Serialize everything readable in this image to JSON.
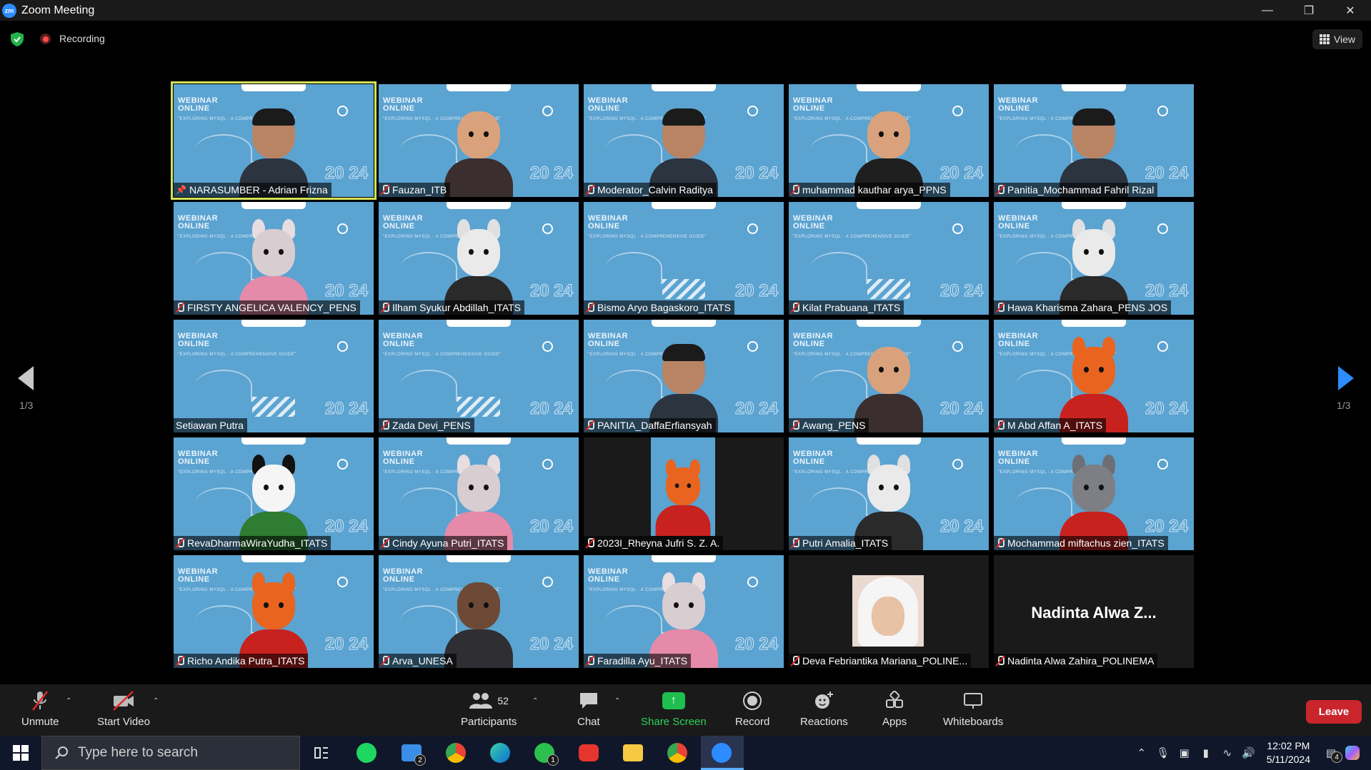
{
  "window": {
    "title": "Zoom Meeting",
    "app_icon": "zm"
  },
  "topbar": {
    "recording_label": "Recording",
    "view_label": "View"
  },
  "pager": {
    "left": "1/3",
    "right": "1/3"
  },
  "tiles": [
    {
      "name": "NARASUMBER - Adrian Frizna",
      "type": "camera",
      "active": true,
      "muted": false,
      "pinned": true
    },
    {
      "name": "Fauzan_ITB",
      "type": "avatar",
      "avatar": "cartoon-man-glasses",
      "muted": true
    },
    {
      "name": "Moderator_Calvin Raditya",
      "type": "camera",
      "muted": true
    },
    {
      "name": "muhammad kauthar arya_PPNS",
      "type": "avatar",
      "avatar": "cartoon-man-sunglasses",
      "muted": true
    },
    {
      "name": "Panitia_Mochammad Fahril Rizal",
      "type": "camera",
      "muted": true
    },
    {
      "name": "FIRSTY ANGELICA VALENCY_PENS",
      "type": "avatar",
      "avatar": "rabbit",
      "muted": true
    },
    {
      "name": "Ilham Syukur Abdillah_ITATS",
      "type": "avatar",
      "avatar": "white-bear",
      "muted": true
    },
    {
      "name": "Bismo Aryo Bagaskoro_ITATS",
      "type": "background",
      "muted": true
    },
    {
      "name": "Kilat Prabuana_ITATS",
      "type": "background",
      "muted": true
    },
    {
      "name": "Hawa Kharisma Zahara_PENS JOS",
      "type": "avatar",
      "avatar": "white-bear",
      "muted": true
    },
    {
      "name": "Setiawan Putra",
      "type": "background",
      "muted": false
    },
    {
      "name": "Zada Devi_PENS",
      "type": "background",
      "muted": true
    },
    {
      "name": "PANITIA_DaffaErfiansyah",
      "type": "camera",
      "muted": true
    },
    {
      "name": "Awang_PENS",
      "type": "avatar",
      "avatar": "cartoon-man-glasses",
      "muted": true
    },
    {
      "name": "M Abd Affan A_ITATS",
      "type": "avatar",
      "avatar": "fox",
      "muted": true
    },
    {
      "name": "RevaDharmaWiraYudha_ITATS",
      "type": "avatar",
      "avatar": "panda",
      "muted": true
    },
    {
      "name": "Cindy Ayuna Putri_ITATS",
      "type": "avatar",
      "avatar": "rabbit",
      "muted": true
    },
    {
      "name": "2023I_Rheyna Jufri S. Z. A.",
      "type": "avatar-narrow",
      "avatar": "fox",
      "muted": true
    },
    {
      "name": "Putri Amalia_ITATS",
      "type": "avatar",
      "avatar": "white-bear",
      "muted": true
    },
    {
      "name": "Mochammad miftachus zien_ITATS",
      "type": "avatar",
      "avatar": "raccoon",
      "muted": true
    },
    {
      "name": "Richo Andika Putra_ITATS",
      "type": "avatar",
      "avatar": "fox",
      "muted": true
    },
    {
      "name": "Arva_UNESA",
      "type": "avatar",
      "avatar": "cartoon-man",
      "muted": true
    },
    {
      "name": "Faradilla Ayu_ITATS",
      "type": "avatar",
      "avatar": "rabbit",
      "muted": true
    },
    {
      "name": "Deva Febriantika Mariana_POLINE...",
      "type": "photo",
      "muted": true
    },
    {
      "name": "Nadinta Alwa Zahira_POLINEMA",
      "type": "no-video",
      "display_name": "Nadinta Alwa Z...",
      "muted": true
    }
  ],
  "background": {
    "line1": "WEBINAR",
    "line2": "ONLINE",
    "sub": "\"EXPLORING MYSQL : A COMPREHENSIVE GUIDE\"",
    "year": "20 24"
  },
  "toolbar": {
    "unmute": "Unmute",
    "start_video": "Start Video",
    "participants": "Participants",
    "participants_count": "52",
    "chat": "Chat",
    "share_screen": "Share Screen",
    "record": "Record",
    "reactions": "Reactions",
    "apps": "Apps",
    "whiteboards": "Whiteboards",
    "leave": "Leave"
  },
  "taskbar": {
    "search_placeholder": "Type here to search",
    "time": "12:02 PM",
    "date": "5/11/2024",
    "mail_badge": "2",
    "whatsapp_badge": "1",
    "notification_badge": "4"
  },
  "colors": {
    "tile_bg": "#5ba3d1",
    "active_border": "#d4e157",
    "share_green": "#1fbf4f",
    "leave_red": "#c9252c",
    "accent_blue": "#2d8cff"
  }
}
